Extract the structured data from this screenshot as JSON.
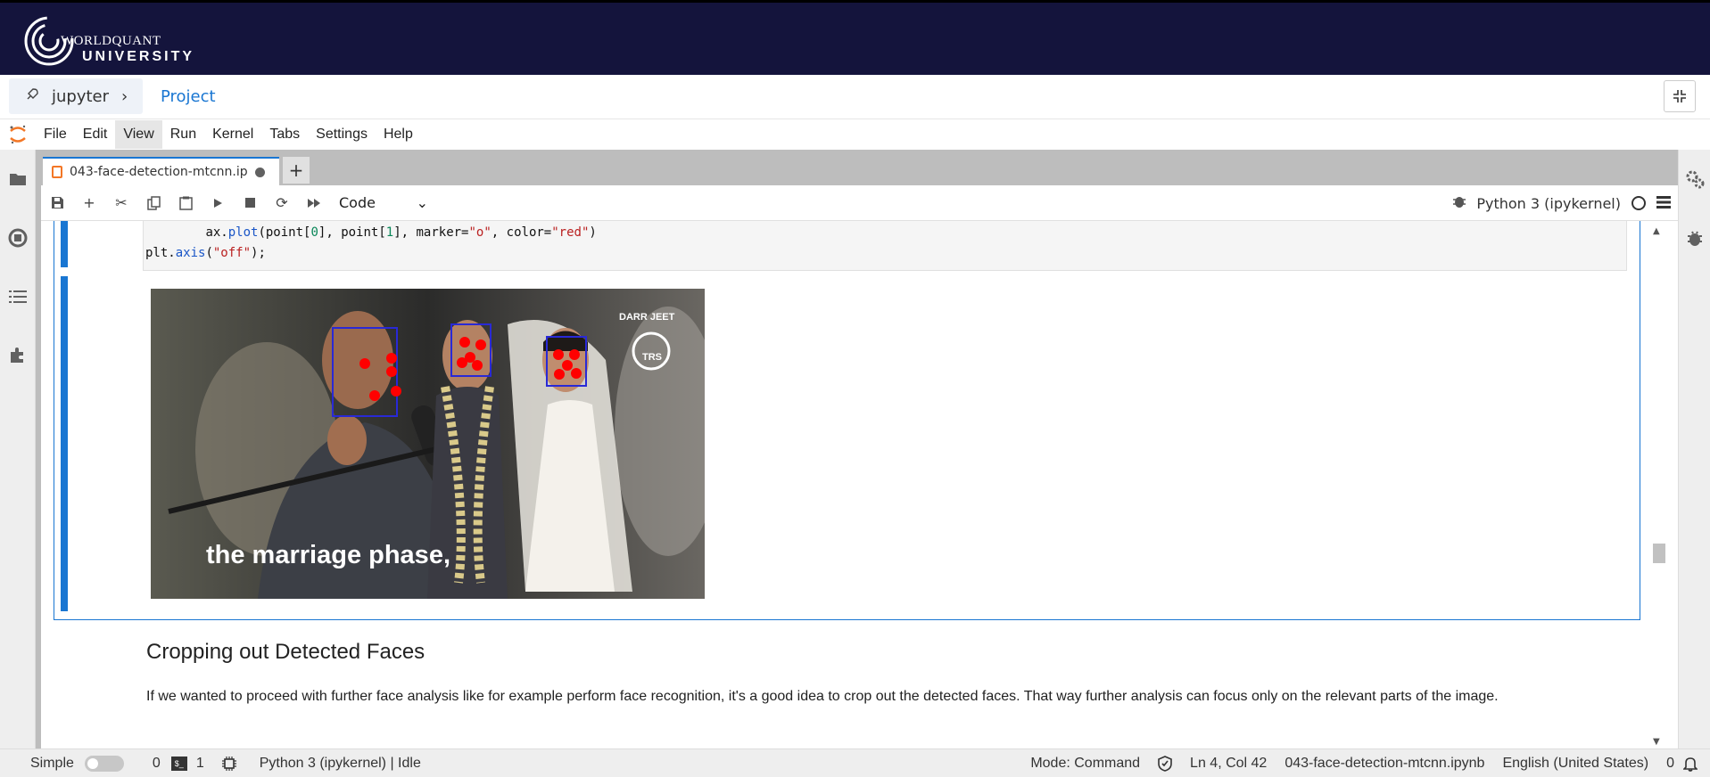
{
  "brand": {
    "line1": "WORLDQUANT",
    "line2": "UNIVERSITY"
  },
  "project_bar": {
    "jupyter_label": "jupyter",
    "project_label": "Project"
  },
  "menu": [
    "File",
    "Edit",
    "View",
    "Run",
    "Kernel",
    "Tabs",
    "Settings",
    "Help"
  ],
  "active_menu": "View",
  "tab": {
    "filename": "043-face-detection-mtcnn.ip"
  },
  "toolbar": {
    "cell_type": "Code",
    "kernel_name": "Python 3 (ipykernel)"
  },
  "code": {
    "line1_indent": "        ",
    "line1_a": "ax.",
    "line1_fn": "plot",
    "line1_b": "(point[",
    "line1_n0": "0",
    "line1_c": "], point[",
    "line1_n1": "1",
    "line1_d": "], marker=",
    "line1_s1": "\"o\"",
    "line1_e": ", color=",
    "line1_s2": "\"red\"",
    "line1_f": ")",
    "line2_a": "plt.",
    "line2_fn": "axis",
    "line2_b": "(",
    "line2_s": "\"off\"",
    "line2_c": ");"
  },
  "output_image": {
    "caption": "the marriage phase,",
    "brand_top": "DARR JEET",
    "brand_badge": "TRS",
    "box_color": "#2929d6",
    "landmark_color": "#ff0000"
  },
  "markdown": {
    "heading": "Cropping out Detected Faces",
    "paragraph": "If we wanted to proceed with further face analysis like for example perform face recognition, it's a good idea to crop out the detected faces. That way further analysis can focus only on the relevant parts of the image."
  },
  "status": {
    "mode_label": "Simple",
    "count_a": "0",
    "count_b": "1",
    "kernel_status": "Python 3 (ipykernel) | Idle",
    "mode": "Mode: Command",
    "position": "Ln 4, Col 42",
    "filename": "043-face-detection-mtcnn.ipynb",
    "language": "English (United States)",
    "notifications": "0"
  },
  "colors": {
    "accent": "#1976d2",
    "brand_bg": "#14143c",
    "jupyter_orange": "#f37726"
  }
}
